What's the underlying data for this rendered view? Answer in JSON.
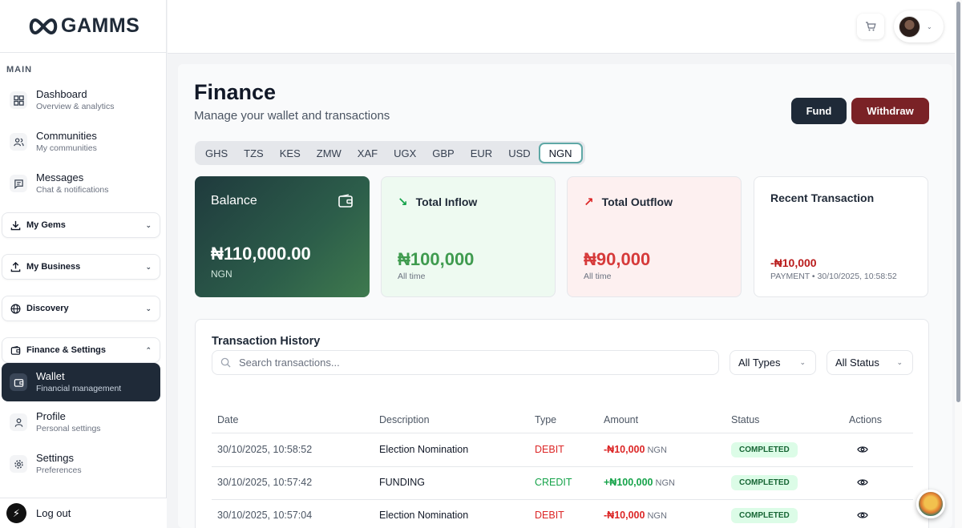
{
  "brand": {
    "name": "GAMMS"
  },
  "sidebar": {
    "section_label": "MAIN",
    "items": [
      {
        "title": "Dashboard",
        "sub": "Overview & analytics",
        "icon": "grid-icon"
      },
      {
        "title": "Communities",
        "sub": "My communities",
        "icon": "users-icon"
      },
      {
        "title": "Messages",
        "sub": "Chat & notifications",
        "icon": "chat-icon"
      }
    ],
    "groups": [
      {
        "label": "My Gems",
        "icon": "download-icon"
      },
      {
        "label": "My Business",
        "icon": "upload-icon"
      },
      {
        "label": "Discovery",
        "icon": "globe-icon"
      },
      {
        "label": "Finance & Settings",
        "icon": "wallet-icon",
        "expanded": true
      }
    ],
    "sub_items": [
      {
        "title": "Wallet",
        "sub": "Financial management",
        "active": true
      },
      {
        "title": "Profile",
        "sub": "Personal settings"
      },
      {
        "title": "Settings",
        "sub": "Preferences"
      }
    ],
    "logout": "Log out"
  },
  "page": {
    "title": "Finance",
    "subtitle": "Manage your wallet and transactions",
    "fund": "Fund",
    "withdraw": "Withdraw"
  },
  "currencies": [
    "GHS",
    "TZS",
    "KES",
    "ZMW",
    "XAF",
    "UGX",
    "GBP",
    "EUR",
    "USD",
    "NGN"
  ],
  "selected_currency": "NGN",
  "cards": {
    "balance": {
      "label": "Balance",
      "amount": "₦110,000.00",
      "currency": "NGN"
    },
    "inflow": {
      "label": "Total Inflow",
      "amount": "₦100,000",
      "sub": "All time"
    },
    "outflow": {
      "label": "Total Outflow",
      "amount": "₦90,000",
      "sub": "All time"
    },
    "recent": {
      "label": "Recent Transaction",
      "amount": "-₦10,000",
      "meta": "PAYMENT • 30/10/2025, 10:58:52"
    }
  },
  "history": {
    "title": "Transaction History",
    "search_placeholder": "Search transactions...",
    "filter_types": "All Types",
    "filter_status": "All Status",
    "columns": [
      "Date",
      "Description",
      "Type",
      "Amount",
      "Status",
      "Actions"
    ],
    "rows": [
      {
        "date": "30/10/2025, 10:58:52",
        "desc": "Election Nomination",
        "type": "DEBIT",
        "amount": "-₦10,000",
        "ccy": "NGN",
        "status": "COMPLETED"
      },
      {
        "date": "30/10/2025, 10:57:42",
        "desc": "FUNDING",
        "type": "CREDIT",
        "amount": "+₦100,000",
        "ccy": "NGN",
        "status": "COMPLETED"
      },
      {
        "date": "30/10/2025, 10:57:04",
        "desc": "Election Nomination",
        "type": "DEBIT",
        "amount": "-₦10,000",
        "ccy": "NGN",
        "status": "COMPLETED"
      }
    ]
  },
  "colors": {
    "sidebar_active": "#1f2a38",
    "withdraw": "#7a2226",
    "debit": "#dc2626",
    "credit": "#16a34a",
    "status_bg": "#dcfce7"
  }
}
